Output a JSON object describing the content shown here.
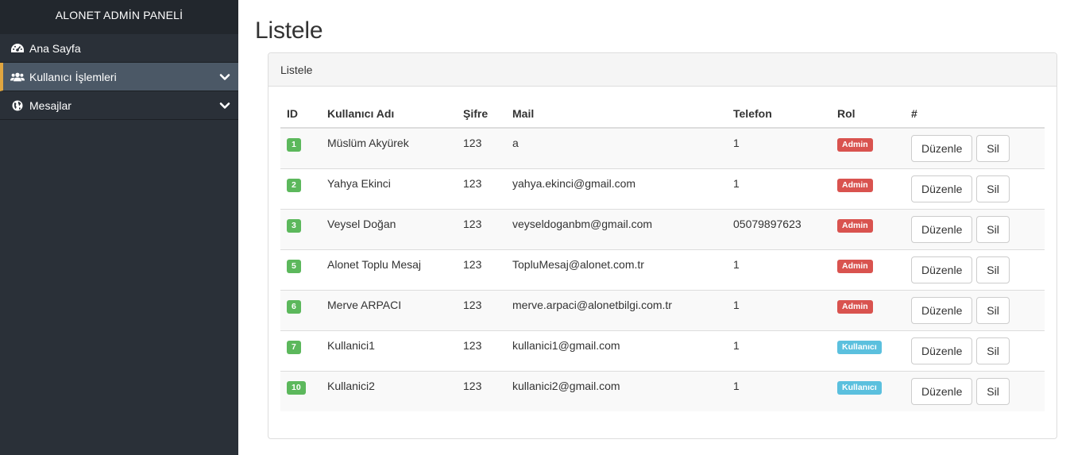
{
  "sidebar": {
    "brand": "ALONET ADMİN PANELİ",
    "items": [
      {
        "label": "Ana Sayfa",
        "icon": "dashboard-icon"
      },
      {
        "label": "Kullanıcı İşlemleri",
        "icon": "users-icon"
      },
      {
        "label": "Mesajlar",
        "icon": "globe-icon"
      }
    ]
  },
  "page": {
    "title": "Listele",
    "panel_heading": "Listele"
  },
  "table": {
    "headers": [
      "ID",
      "Kullanıcı Adı",
      "Şifre",
      "Mail",
      "Telefon",
      "Rol",
      "#"
    ],
    "rows": [
      {
        "id": "1",
        "name": "Müslüm Akyürek",
        "password": "123",
        "mail": "a",
        "phone": "1",
        "role": "Admin"
      },
      {
        "id": "2",
        "name": "Yahya Ekinci",
        "password": "123",
        "mail": "yahya.ekinci@gmail.com",
        "phone": "1",
        "role": "Admin"
      },
      {
        "id": "3",
        "name": "Veysel Doğan",
        "password": "123",
        "mail": "veyseldoganbm@gmail.com",
        "phone": "05079897623",
        "role": "Admin"
      },
      {
        "id": "5",
        "name": "Alonet Toplu Mesaj",
        "password": "123",
        "mail": "TopluMesaj@alonet.com.tr",
        "phone": "1",
        "role": "Admin"
      },
      {
        "id": "6",
        "name": "Merve ARPACI",
        "password": "123",
        "mail": "merve.arpaci@alonetbilgi.com.tr",
        "phone": "1",
        "role": "Admin"
      },
      {
        "id": "7",
        "name": "Kullanici1",
        "password": "123",
        "mail": "kullanici1@gmail.com",
        "phone": "1",
        "role": "Kullanıcı"
      },
      {
        "id": "10",
        "name": "Kullanici2",
        "password": "123",
        "mail": "kullanici2@gmail.com",
        "phone": "1",
        "role": "Kullanıcı"
      }
    ],
    "edit_label": "Düzenle",
    "delete_label": "Sil"
  },
  "colors": {
    "sidebar_bg": "#2a3038",
    "active_accent": "#e0a640",
    "id_badge": "#5cb85c",
    "admin_badge": "#d9534f",
    "user_badge": "#5bc0de"
  }
}
